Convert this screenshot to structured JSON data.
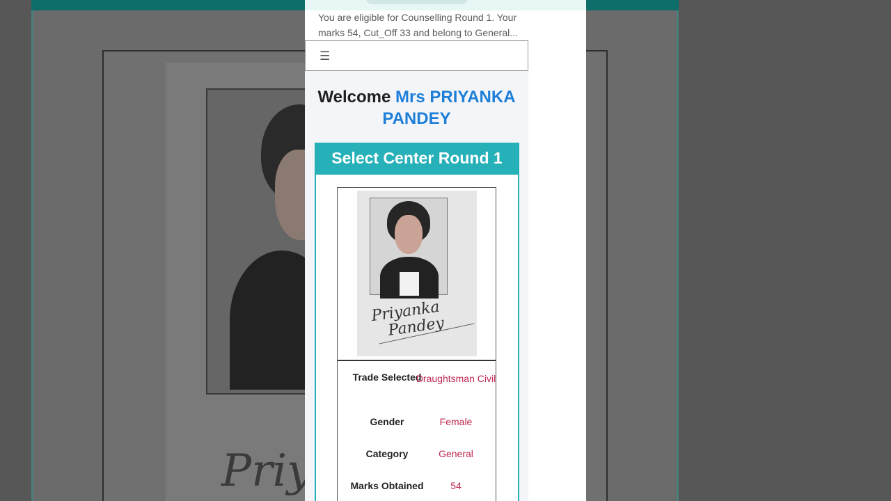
{
  "notice": {
    "text": "You are eligible for Counselling Round 1. Your marks 54, Cut_Off 33 and belong to General..."
  },
  "nav": {
    "menu_icon": "☰"
  },
  "welcome": {
    "greeting": "Welcome",
    "name": "Mrs PRIYANKA PANDEY"
  },
  "card": {
    "title": "Select Center Round 1"
  },
  "profile": {
    "signature_text": "Priyanka Pandey",
    "fields": [
      {
        "label": "Trade Selected",
        "value": "Draughtsman Civil"
      },
      {
        "label": "Gender",
        "value": "Female"
      },
      {
        "label": "Category",
        "value": "General"
      },
      {
        "label": "Marks Obtained",
        "value": "54"
      }
    ]
  },
  "colors": {
    "accent_teal": "#26b0b8",
    "name_blue": "#1e7fd9",
    "value_red": "#c0284f"
  }
}
